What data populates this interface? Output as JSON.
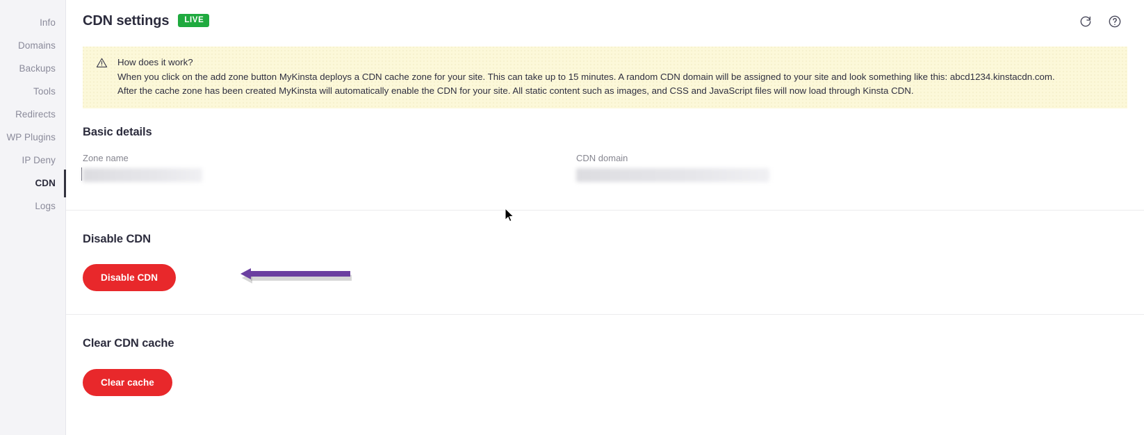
{
  "sidebar": {
    "items": [
      {
        "label": "Info",
        "active": false
      },
      {
        "label": "Domains",
        "active": false
      },
      {
        "label": "Backups",
        "active": false
      },
      {
        "label": "Tools",
        "active": false
      },
      {
        "label": "Redirects",
        "active": false
      },
      {
        "label": "WP Plugins",
        "active": false
      },
      {
        "label": "IP Deny",
        "active": false
      },
      {
        "label": "CDN",
        "active": true
      },
      {
        "label": "Logs",
        "active": false
      }
    ]
  },
  "header": {
    "title": "CDN settings",
    "badge": "LIVE",
    "refresh_icon": "refresh-icon",
    "help_icon": "help-circle-icon"
  },
  "notice": {
    "icon": "warning-triangle-icon",
    "heading": "How does it work?",
    "line2": "When you click on the add zone button MyKinsta deploys a CDN cache zone for your site. This can take up to 15 minutes. A random CDN domain will be assigned to your site and look something like this: abcd1234.kinstacdn.com.",
    "line3": "After the cache zone has been created MyKinsta will automatically enable the CDN for your site. All static content such as images, and CSS and JavaScript files will now load through Kinsta CDN.",
    "background_color": "#fcf8d9"
  },
  "basic_details": {
    "title": "Basic details",
    "zone_name": {
      "label": "Zone name",
      "value": "",
      "redacted": true
    },
    "cdn_domain": {
      "label": "CDN domain",
      "value": "",
      "redacted": true
    }
  },
  "disable_cdn": {
    "title": "Disable CDN",
    "button_label": "Disable CDN",
    "button_color": "#e8282b"
  },
  "clear_cache": {
    "title": "Clear CDN cache",
    "button_label": "Clear cache",
    "button_color": "#e8282b"
  },
  "annotation": {
    "arrow_color": "#6b3fa0",
    "points_to": "disable-cdn-button"
  },
  "colors": {
    "accent_green": "#1faa3f",
    "danger_red": "#e8282b",
    "sidebar_bg": "#f4f4f7",
    "notice_bg": "#fcf8d9",
    "text_dark": "#2c2c3d"
  }
}
